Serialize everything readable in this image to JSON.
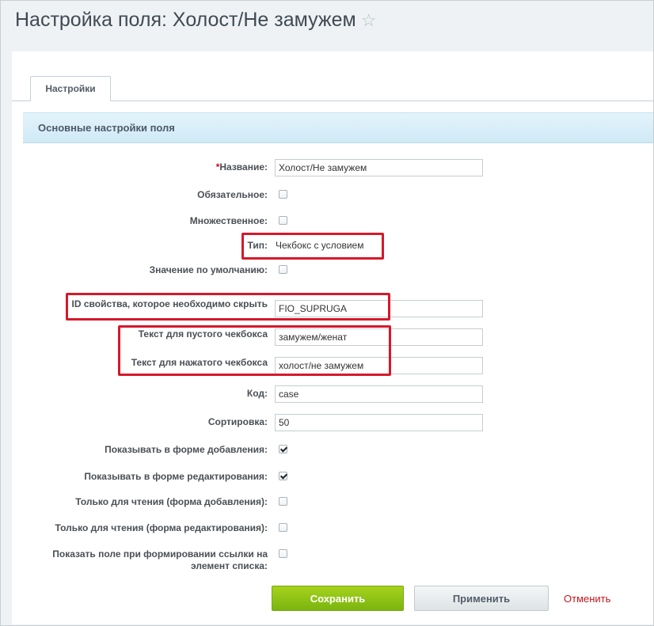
{
  "page": {
    "title": "Настройка поля: Холост/Не замужем",
    "star": "☆"
  },
  "tabs": [
    {
      "label": "Настройки"
    }
  ],
  "section": {
    "title": "Основные настройки поля"
  },
  "fields": {
    "name": {
      "required_mark": "*",
      "label": "Название:",
      "value": "Холост/Не замужем"
    },
    "mandatory": {
      "label": "Обязательное:",
      "checked": false
    },
    "multiple": {
      "label": "Множественное:",
      "checked": false
    },
    "type": {
      "label": "Тип:",
      "value": "Чекбокс с условием"
    },
    "default_value": {
      "label": "Значение по умолчанию:",
      "checked": false
    },
    "property_id": {
      "label": "ID свойства, которое необходимо скрыть",
      "value": "FIO_SUPRUGA"
    },
    "empty_text": {
      "label": "Текст для пустого чекбокса",
      "value": "замужем/женат"
    },
    "checked_text": {
      "label": "Текст для нажатого чекбокса",
      "value": "холост/не замужем"
    },
    "code": {
      "label": "Код:",
      "value": "case"
    },
    "sort": {
      "label": "Сортировка:",
      "value": "50"
    },
    "show_add": {
      "label": "Показывать в форме добавления:",
      "checked": true
    },
    "show_edit": {
      "label": "Показывать в форме редактирования:",
      "checked": true
    },
    "readonly_add": {
      "label": "Только для чтения (форма добавления):",
      "checked": false
    },
    "readonly_edit": {
      "label": "Только для чтения (форма редактирования):",
      "checked": false
    },
    "show_in_link": {
      "label_line1": "Показать поле при формировании ссылки на",
      "label_line2": "элемент списка:",
      "checked": false
    }
  },
  "buttons": {
    "save": "Сохранить",
    "apply": "Применить",
    "cancel": "Отменить"
  },
  "colors": {
    "highlight_box": "#d6182b",
    "save_button": "#8cc314",
    "cancel_link": "#c0171d"
  }
}
